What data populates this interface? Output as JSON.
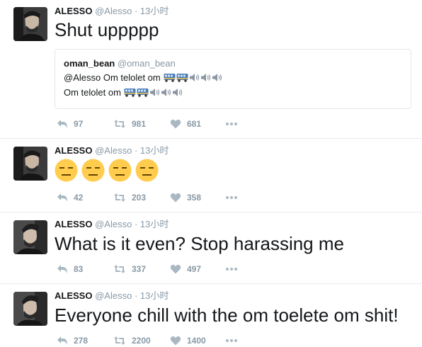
{
  "colors": {
    "text": "#14171a",
    "muted": "#8899a6",
    "action_icon": "#aab8c2",
    "divider": "#e6ecf0"
  },
  "tweets": [
    {
      "author_name": "ALESSO",
      "author_handle": "@Alesso",
      "separator": "·",
      "time": "13小时",
      "text": "Shut uppppp",
      "quote": {
        "author_name": "oman_bean",
        "author_handle": "@oman_bean",
        "line1": "@Alesso Om telolet om",
        "line2": "Om telolet om",
        "emoji_icons": [
          "bus-icon",
          "bus-icon",
          "speaker-loud-icon",
          "speaker-loud-icon",
          "speaker-loud-icon"
        ]
      },
      "actions": {
        "reply": "97",
        "retweet": "981",
        "like": "681"
      }
    },
    {
      "author_name": "ALESSO",
      "author_handle": "@Alesso",
      "separator": "·",
      "time": "13小时",
      "emoji_icons": [
        "expressionless-face-icon",
        "expressionless-face-icon",
        "expressionless-face-icon",
        "expressionless-face-icon"
      ],
      "actions": {
        "reply": "42",
        "retweet": "203",
        "like": "358"
      }
    },
    {
      "author_name": "ALESSO",
      "author_handle": "@Alesso",
      "separator": "·",
      "time": "13小时",
      "text": "What is it even? Stop harassing me",
      "actions": {
        "reply": "83",
        "retweet": "337",
        "like": "497"
      }
    },
    {
      "author_name": "ALESSO",
      "author_handle": "@Alesso",
      "separator": "·",
      "time": "13小时",
      "text": "Everyone chill with the om toelete om shit!",
      "actions": {
        "reply": "278",
        "retweet": "2200",
        "like": "1400"
      }
    }
  ]
}
